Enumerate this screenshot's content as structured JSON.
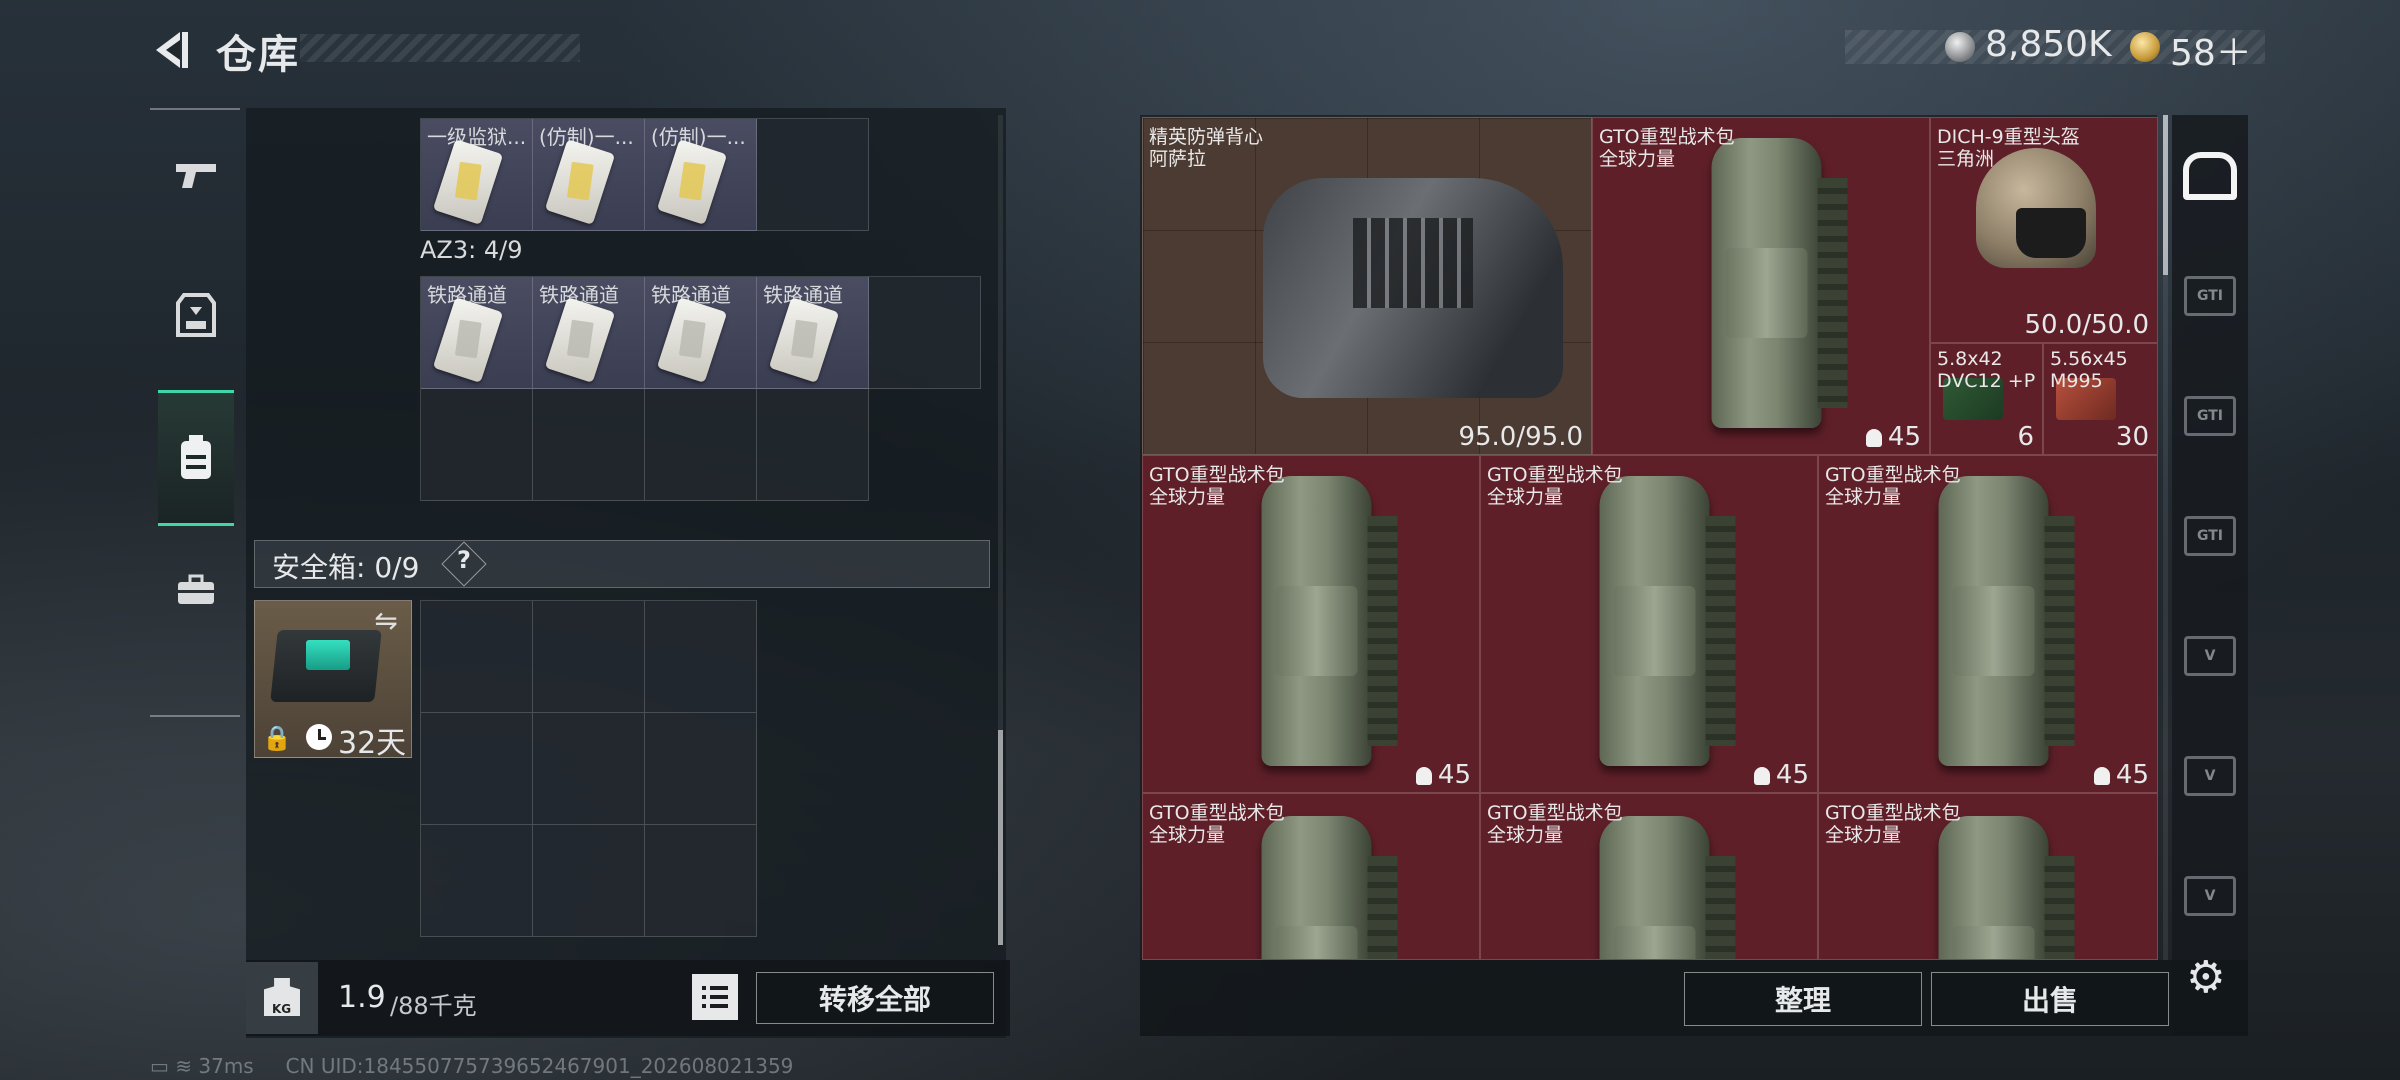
{
  "header": {
    "title": "仓库",
    "money": "8,850K",
    "tickets": "58＋"
  },
  "left_nav": {
    "items": [
      "weapon-icon",
      "vest-icon",
      "backpack-icon",
      "case-icon"
    ],
    "active": 2
  },
  "containers": {
    "row_top_labels": [
      "一级监狱...",
      "(仿制)一...",
      "(仿制)一..."
    ],
    "az3_label": "AZ3: 4/9",
    "az3_labels": [
      "铁路通道",
      "铁路通道",
      "铁路通道",
      "铁路通道"
    ]
  },
  "safebox": {
    "label": "安全箱: 0/9",
    "help": "?",
    "days": "32天"
  },
  "bottom": {
    "weight": "1.9",
    "weight_max": "/88千克",
    "kg": "KG",
    "transfer": "转移全部"
  },
  "stash": {
    "items": [
      {
        "n1": "精英防弹背心",
        "n2": "阿萨拉",
        "count": "95.0/95.0"
      },
      {
        "n1": "GTO重型战术包",
        "n2": "全球力量",
        "count": "45"
      },
      {
        "n1": "DICH-9重型头盔",
        "n2": "三角洲",
        "count": "50.0/50.0"
      },
      {
        "n1": "5.8x42",
        "n2": "DVC12 +P",
        "count": "6"
      },
      {
        "n1": "5.56x45",
        "n2": "M995",
        "count": "30"
      },
      {
        "n1": "GTO重型战术包",
        "n2": "全球力量",
        "count": "45"
      },
      {
        "n1": "GTO重型战术包",
        "n2": "全球力量",
        "count": "45"
      },
      {
        "n1": "GTO重型战术包",
        "n2": "全球力量",
        "count": "45"
      },
      {
        "n1": "GTO重型战术包",
        "n2": "全球力量",
        "count": ""
      },
      {
        "n1": "GTO重型战术包",
        "n2": "全球力量",
        "count": ""
      },
      {
        "n1": "GTO重型战术包",
        "n2": "全球力量",
        "count": ""
      }
    ]
  },
  "right_col": {
    "labels": [
      "GTI",
      "GTI",
      "GTI",
      "V",
      "V",
      "V"
    ]
  },
  "actions": {
    "sort": "整理",
    "sell": "出售"
  },
  "status": {
    "ping": "37ms",
    "uid": "CN UID:18455077573965246790​1_202608021359"
  },
  "colors": {
    "accent": "#3fd6a8",
    "item_red": "#5e1f28",
    "item_vest": "#4c3b32",
    "card_purple": "#4a4d62"
  }
}
